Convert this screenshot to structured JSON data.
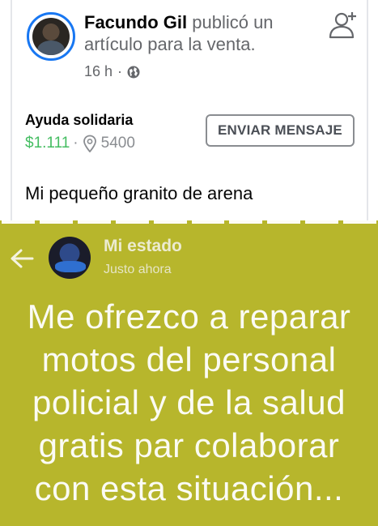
{
  "post": {
    "author": "Facundo Gil",
    "action": " publicó un artículo para la venta.",
    "time": "16 h",
    "separator": "·",
    "item_title": "Ayuda solidaria",
    "price": "$1.111",
    "location": "5400",
    "send_button": "ENVIAR MENSAJE",
    "text": "Mi pequeño granito de arena"
  },
  "status": {
    "name": "Mi estado",
    "time": "Justo ahora",
    "lines": [
      "Me ofrezco a reparar",
      "motos del personal",
      "policial y de la salud",
      "gratis par colaborar",
      "con esta situación..."
    ],
    "progress_segments": 10,
    "background_color": "#b7b62c"
  },
  "colors": {
    "accent": "#1877f2",
    "price": "#45bd62"
  },
  "icons": [
    "globe-icon",
    "add-friend-icon",
    "location-pin-icon",
    "back-arrow-icon"
  ]
}
